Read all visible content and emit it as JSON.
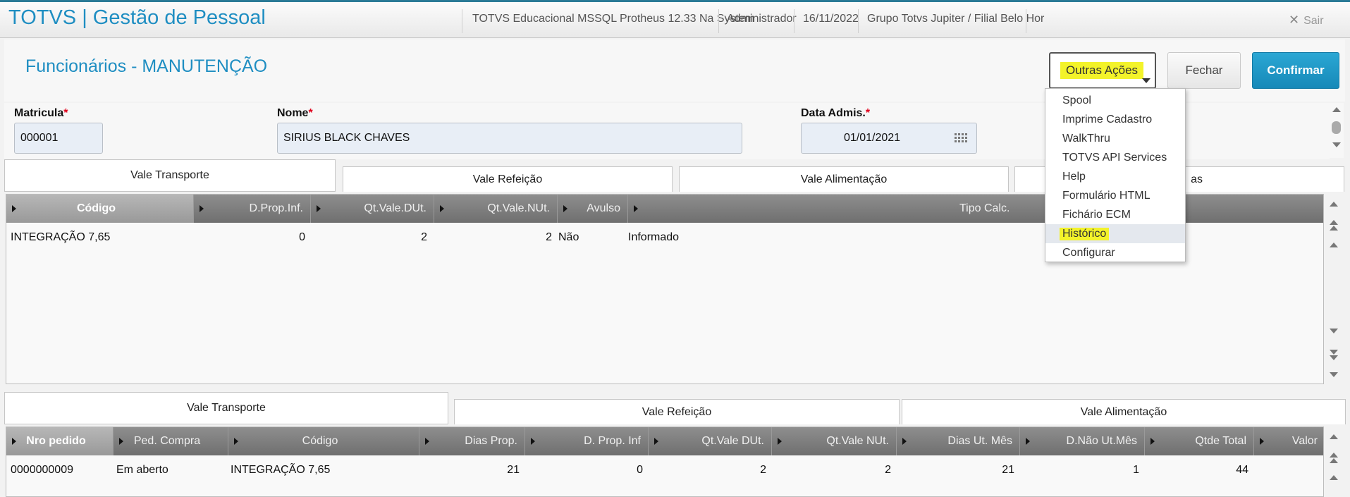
{
  "topbar": {
    "app_title": "TOTVS | Gestão de Pessoal",
    "environment": "TOTVS Educacional MSSQL Protheus 12.33 Na System",
    "user": "Administrador",
    "date": "16/11/2022",
    "company": "Grupo Totvs Jupiter / Filial Belo Hor",
    "logout_label": "Sair"
  },
  "header": {
    "page_title": "Funcionários - MANUTENÇÃO",
    "outras_acoes_label": "Outras Ações",
    "fechar_label": "Fechar",
    "confirmar_label": "Confirmar"
  },
  "form": {
    "matricula_label": "Matricula",
    "matricula_value": "000001",
    "nome_label": "Nome",
    "nome_value": "SIRIUS BLACK CHAVES",
    "data_admis_label": "Data Admis.",
    "data_admis_value": "01/01/2021",
    "required_mark": "*"
  },
  "tabs_top": [
    "Vale Transporte",
    "Vale Refeição",
    "Vale Alimentação",
    "as"
  ],
  "grid_top": {
    "columns": [
      "Código",
      "D.Prop.Inf.",
      "Qt.Vale.DUt.",
      "Qt.Vale.NUt.",
      "Avulso",
      "Tipo Calc."
    ],
    "rows": [
      [
        "INTEGRAÇÃO 7,65",
        "0",
        "2",
        "2",
        "Não",
        "Informado"
      ]
    ]
  },
  "tabs_bottom": [
    "Vale Transporte",
    "Vale Refeição",
    "Vale Alimentação"
  ],
  "grid_bottom": {
    "columns": [
      "Nro pedido",
      "Ped. Compra",
      "Código",
      "Dias Prop.",
      "D. Prop. Inf",
      "Qt.Vale DUt.",
      "Qt.Vale NUt.",
      "Dias Ut. Mês",
      "D.Não Ut.Mês",
      "Qtde Total",
      "Valor"
    ],
    "rows": [
      [
        "0000000009",
        "Em aberto",
        "INTEGRAÇÃO 7,65",
        "21",
        "0",
        "2",
        "2",
        "21",
        "1",
        "44",
        ""
      ]
    ]
  },
  "menu": {
    "items": [
      "Spool",
      "Imprime Cadastro",
      "WalkThru",
      "TOTVS API Services",
      "Help",
      "Formulário HTML",
      "Fichário ECM",
      "Histórico",
      "Configurar"
    ],
    "selected": "Histórico"
  },
  "colors": {
    "accent": "#1f8ec2",
    "confirm": "#1a8fbf",
    "highlight": "#f3f32a",
    "grid_header": "#7f7f7f"
  }
}
